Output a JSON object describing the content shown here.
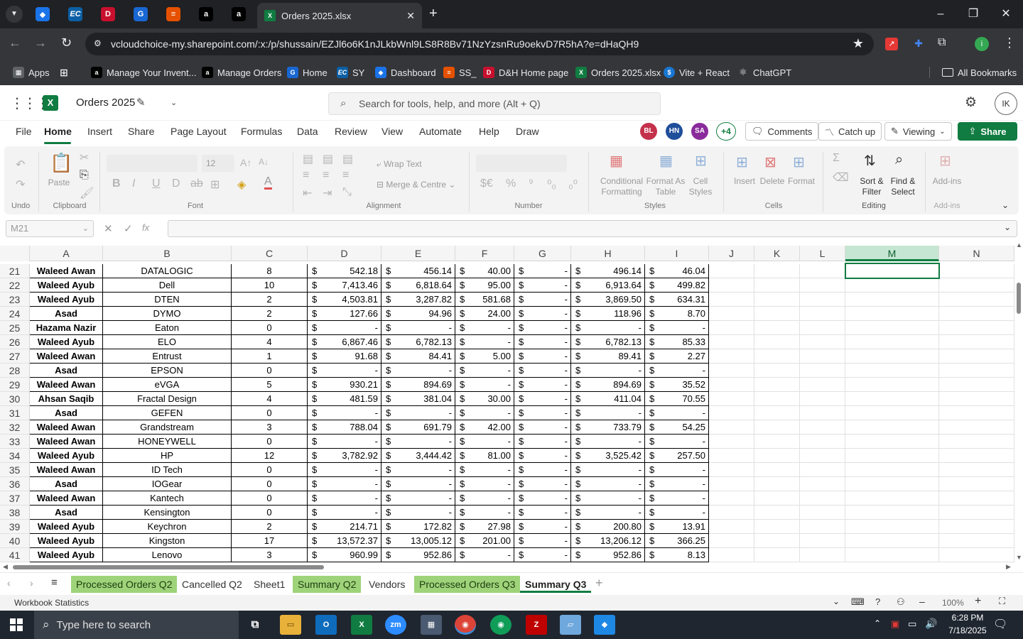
{
  "browser": {
    "active_tab_title": "Orders 2025.xlsx",
    "url": "vcloudchoice-my.sharepoint.com/:x:/p/shussain/EZJl6o6K1nJLkbWnl9LS8R8Bv71NzYzsnRu9oekvD7R5hA?e=dHaQH9",
    "bookmarks": [
      "Apps",
      "Manage Your Invent...",
      "Manage Orders",
      "Home",
      "SY",
      "Dashboard",
      "SS_",
      "D&H Home page",
      "Orders 2025.xlsx",
      "Vite + React",
      "ChatGPT"
    ],
    "all_bookmarks": "All Bookmarks"
  },
  "excel": {
    "doc_title": "Orders 2025",
    "search_placeholder": "Search for tools, help, and more (Alt + Q)",
    "menu": [
      "File",
      "Home",
      "Insert",
      "Share",
      "Page Layout",
      "Formulas",
      "Data",
      "Review",
      "View",
      "Automate",
      "Help",
      "Draw"
    ],
    "avatars": [
      "BL",
      "HN",
      "SA",
      "+4"
    ],
    "comments": "Comments",
    "catch_up": "Catch up",
    "viewing": "Viewing",
    "share": "Share",
    "accent": "#107c41"
  },
  "ribbon": {
    "undo_group": "Undo",
    "clipboard_group": "Clipboard",
    "paste": "Paste",
    "font_group": "Font",
    "font_size": "12",
    "alignment_group": "Alignment",
    "wrap_text": "Wrap Text",
    "merge_centre": "Merge & Centre",
    "number_group": "Number",
    "styles_group": "Styles",
    "conditional_formatting": "Conditional Formatting",
    "format_as_table": "Format As Table",
    "cell_styles": "Cell Styles",
    "cells_group": "Cells",
    "insert": "Insert",
    "delete": "Delete",
    "format": "Format",
    "editing_group": "Editing",
    "sort_filter": "Sort & Filter",
    "find_select": "Find & Select",
    "addins_group": "Add-ins",
    "addins": "Add-ins"
  },
  "formula_bar": {
    "name_box": "M21",
    "formula": ""
  },
  "columns": [
    "A",
    "B",
    "C",
    "D",
    "E",
    "F",
    "G",
    "H",
    "I",
    "J",
    "K",
    "L",
    "M",
    "N"
  ],
  "selected_column": "M",
  "rows": [
    {
      "n": "21",
      "a": "Waleed Awan",
      "b": "DATALOGIC",
      "c": "8",
      "d": "542.18",
      "e": "456.14",
      "f": "40.00",
      "g": "-",
      "h": "496.14",
      "i": "46.04"
    },
    {
      "n": "22",
      "a": "Waleed Ayub",
      "b": "Dell",
      "c": "10",
      "d": "7,413.46",
      "e": "6,818.64",
      "f": "95.00",
      "g": "-",
      "h": "6,913.64",
      "i": "499.82"
    },
    {
      "n": "23",
      "a": "Waleed Ayub",
      "b": "DTEN",
      "c": "2",
      "d": "4,503.81",
      "e": "3,287.82",
      "f": "581.68",
      "g": "-",
      "h": "3,869.50",
      "i": "634.31"
    },
    {
      "n": "24",
      "a": "Asad",
      "b": "DYMO",
      "c": "2",
      "d": "127.66",
      "e": "94.96",
      "f": "24.00",
      "g": "-",
      "h": "118.96",
      "i": "8.70"
    },
    {
      "n": "25",
      "a": "Hazama Nazir",
      "b": "Eaton",
      "c": "0",
      "d": "-",
      "e": "-",
      "f": "-",
      "g": "-",
      "h": "-",
      "i": "-"
    },
    {
      "n": "26",
      "a": "Waleed Ayub",
      "b": "ELO",
      "c": "4",
      "d": "6,867.46",
      "e": "6,782.13",
      "f": "-",
      "g": "-",
      "h": "6,782.13",
      "i": "85.33"
    },
    {
      "n": "27",
      "a": "Waleed Awan",
      "b": "Entrust",
      "c": "1",
      "d": "91.68",
      "e": "84.41",
      "f": "5.00",
      "g": "-",
      "h": "89.41",
      "i": "2.27"
    },
    {
      "n": "28",
      "a": "Asad",
      "b": "EPSON",
      "c": "0",
      "d": "-",
      "e": "-",
      "f": "-",
      "g": "-",
      "h": "-",
      "i": "-"
    },
    {
      "n": "29",
      "a": "Waleed Awan",
      "b": "eVGA",
      "c": "5",
      "d": "930.21",
      "e": "894.69",
      "f": "-",
      "g": "-",
      "h": "894.69",
      "i": "35.52"
    },
    {
      "n": "30",
      "a": "Ahsan Saqib",
      "b": "Fractal Design",
      "c": "4",
      "d": "481.59",
      "e": "381.04",
      "f": "30.00",
      "g": "-",
      "h": "411.04",
      "i": "70.55"
    },
    {
      "n": "31",
      "a": "Asad",
      "b": "GEFEN",
      "c": "0",
      "d": "-",
      "e": "-",
      "f": "-",
      "g": "-",
      "h": "-",
      "i": "-"
    },
    {
      "n": "32",
      "a": "Waleed Awan",
      "b": "Grandstream",
      "c": "3",
      "d": "788.04",
      "e": "691.79",
      "f": "42.00",
      "g": "-",
      "h": "733.79",
      "i": "54.25"
    },
    {
      "n": "33",
      "a": "Waleed Awan",
      "b": "HONEYWELL",
      "c": "0",
      "d": "-",
      "e": "-",
      "f": "-",
      "g": "-",
      "h": "-",
      "i": "-"
    },
    {
      "n": "34",
      "a": "Waleed Ayub",
      "b": "HP",
      "c": "12",
      "d": "3,782.92",
      "e": "3,444.42",
      "f": "81.00",
      "g": "-",
      "h": "3,525.42",
      "i": "257.50"
    },
    {
      "n": "35",
      "a": "Waleed Awan",
      "b": "ID Tech",
      "c": "0",
      "d": "-",
      "e": "-",
      "f": "-",
      "g": "-",
      "h": "-",
      "i": "-"
    },
    {
      "n": "36",
      "a": "Asad",
      "b": "IOGear",
      "c": "0",
      "d": "-",
      "e": "-",
      "f": "-",
      "g": "-",
      "h": "-",
      "i": "-"
    },
    {
      "n": "37",
      "a": "Waleed Awan",
      "b": "Kantech",
      "c": "0",
      "d": "-",
      "e": "-",
      "f": "-",
      "g": "-",
      "h": "-",
      "i": "-"
    },
    {
      "n": "38",
      "a": "Asad",
      "b": "Kensington",
      "c": "0",
      "d": "-",
      "e": "-",
      "f": "-",
      "g": "-",
      "h": "-",
      "i": "-"
    },
    {
      "n": "39",
      "a": "Waleed Ayub",
      "b": "Keychron",
      "c": "2",
      "d": "214.71",
      "e": "172.82",
      "f": "27.98",
      "g": "-",
      "h": "200.80",
      "i": "13.91"
    },
    {
      "n": "40",
      "a": "Waleed Ayub",
      "b": "Kingston",
      "c": "17",
      "d": "13,572.37",
      "e": "13,005.12",
      "f": "201.00",
      "g": "-",
      "h": "13,206.12",
      "i": "366.25"
    },
    {
      "n": "41",
      "a": "Waleed Ayub",
      "b": "Lenovo",
      "c": "3",
      "d": "960.99",
      "e": "952.86",
      "f": "-",
      "g": "-",
      "h": "952.86",
      "i": "8.13"
    }
  ],
  "currency_symbol": "$",
  "sheets": [
    {
      "name": "Processed Orders Q2",
      "style": "green"
    },
    {
      "name": "Cancelled Q2",
      "style": "plain"
    },
    {
      "name": "Sheet1",
      "style": "plain"
    },
    {
      "name": "Summary Q2",
      "style": "green"
    },
    {
      "name": "Vendors",
      "style": "plain"
    },
    {
      "name": "Processed Orders Q3",
      "style": "green"
    },
    {
      "name": "Summary Q3",
      "style": "active"
    }
  ],
  "status_bar": {
    "left": "Workbook Statistics",
    "zoom": "100%"
  },
  "taskbar": {
    "search_placeholder": "Type here to search",
    "time": "6:28 PM",
    "date": "7/18/2025"
  }
}
